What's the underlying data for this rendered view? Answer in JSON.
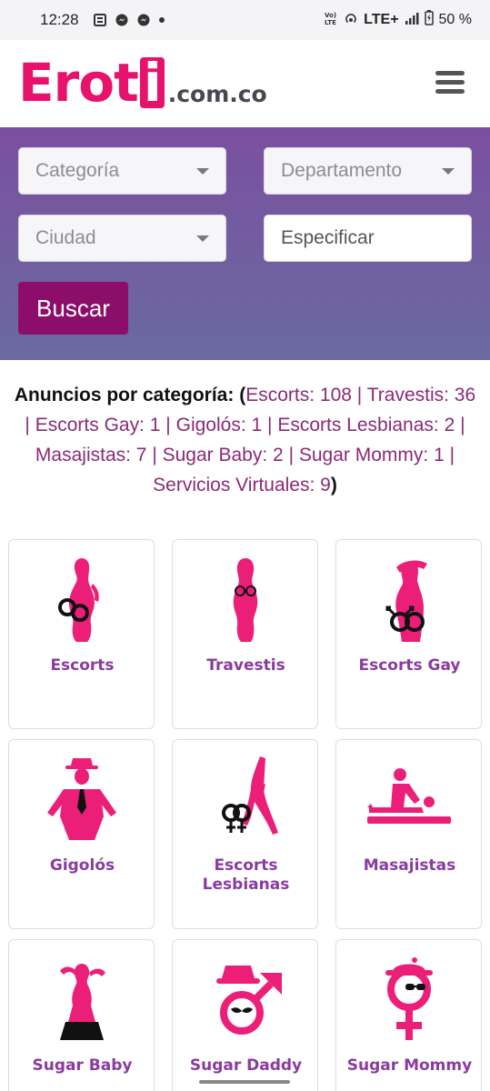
{
  "status_bar": {
    "time": "12:28",
    "network": "LTE+",
    "battery": "50 %"
  },
  "header": {
    "logo_prefix": "Ero",
    "logo_t": "t",
    "logo_i": "i",
    "logo_domain": ".com.co",
    "menu_icon": "hamburger-menu-icon"
  },
  "search": {
    "categoria": "Categoría",
    "departamento": "Departamento",
    "ciudad": "Ciudad",
    "especificar": "Especificar",
    "buscar": "Buscar"
  },
  "summary": {
    "label": "Anuncios por categoría:",
    "open": "(",
    "close": ")",
    "items": [
      "Escorts: 108",
      "Travestis: 36",
      "Escorts Gay: 1",
      "Gigolós: 1",
      "Escorts Lesbianas: 2",
      "Masajistas: 7",
      "Sugar Baby: 2",
      "Sugar Mommy: 1",
      "Servicios Virtuales: 9"
    ]
  },
  "categories": [
    {
      "label": "Escorts",
      "icon": "woman-handcuffs-icon"
    },
    {
      "label": "Travestis",
      "icon": "woman-silhouette-icon"
    },
    {
      "label": "Escorts Gay",
      "icon": "gay-symbol-icon"
    },
    {
      "label": "Gigolós",
      "icon": "man-hat-tie-icon"
    },
    {
      "label": "Escorts Lesbianas",
      "icon": "lesbian-symbol-icon"
    },
    {
      "label": "Masajistas",
      "icon": "massage-icon"
    },
    {
      "label": "Sugar Baby",
      "icon": "dancer-silhouette-icon"
    },
    {
      "label": "Sugar Daddy",
      "icon": "male-symbol-hat-icon"
    },
    {
      "label": "Sugar Mommy",
      "icon": "female-symbol-hat-icon"
    }
  ],
  "colors": {
    "brand": "#e6126b",
    "button": "#8c0e6a",
    "link": "#8c2a76",
    "card_label": "#8b3aa0"
  }
}
